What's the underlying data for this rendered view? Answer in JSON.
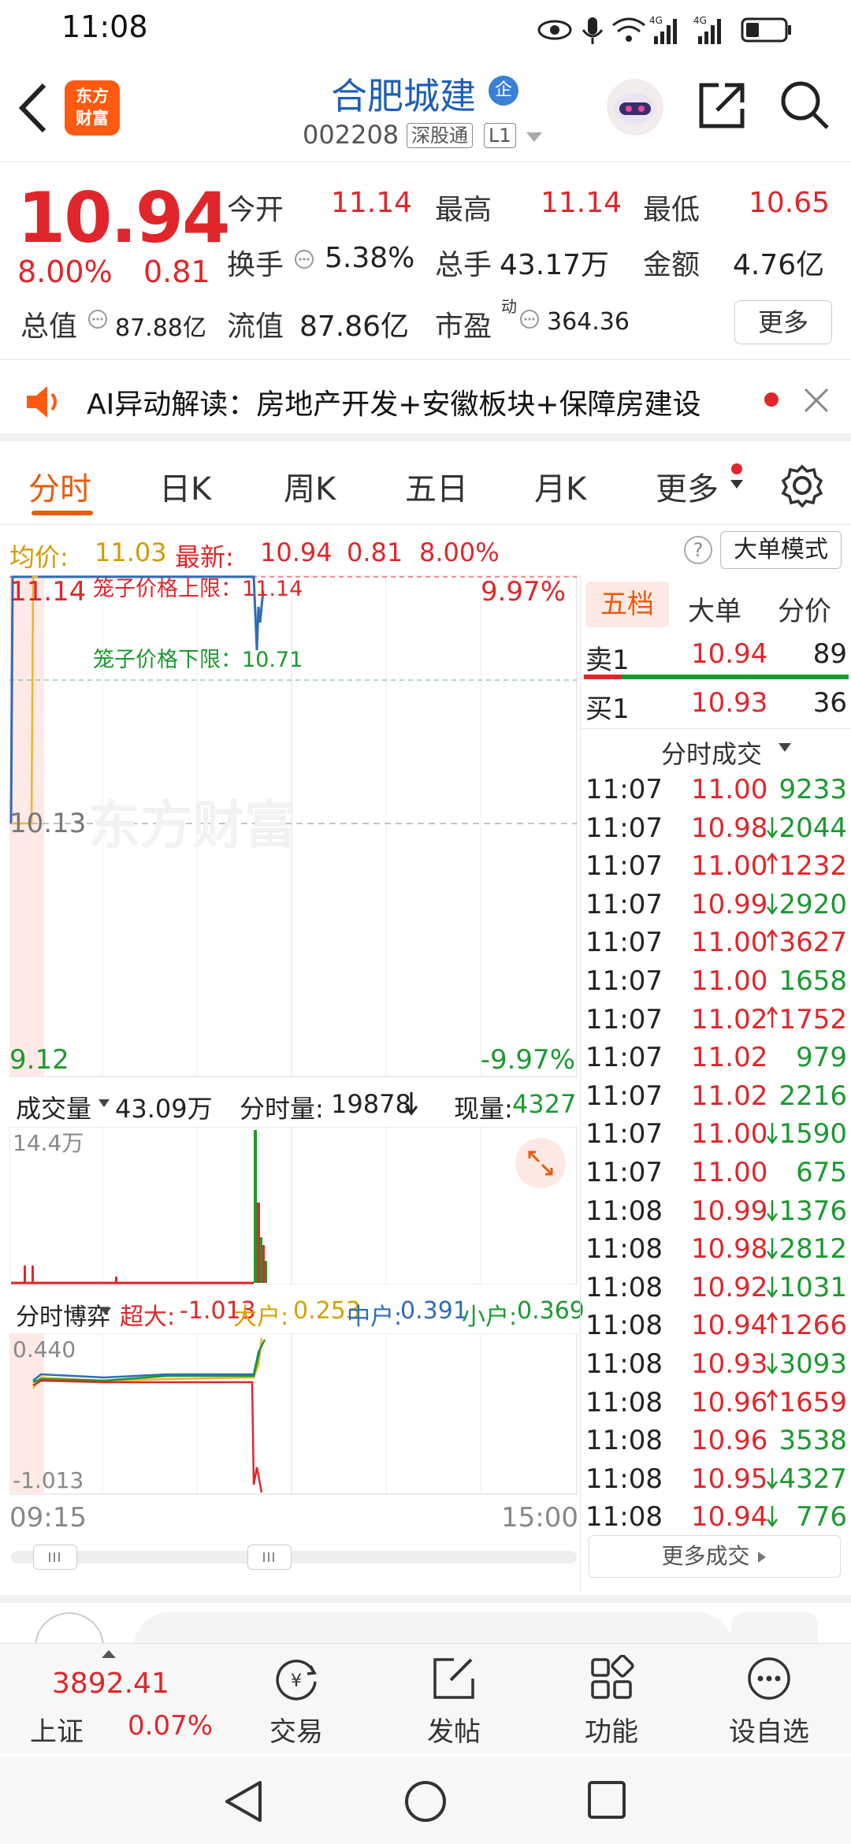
{
  "status_bar": {
    "time": "11:08",
    "network1": "4G",
    "network2": "4G"
  },
  "header": {
    "stock_name": "合肥城建",
    "name_tag": "企",
    "stock_code": "002208",
    "tag_connect": "深股通",
    "tag_level": "L1",
    "logo_line1": "东方",
    "logo_line2": "财富"
  },
  "quote": {
    "price": "10.94",
    "change_pct": "8.00%",
    "change": "0.81",
    "open_label": "今开",
    "open": "11.14",
    "high_label": "最高",
    "high": "11.14",
    "low_label": "最低",
    "low": "10.65",
    "turnover_label": "换手",
    "turnover": "5.38%",
    "volume_label": "总手",
    "volume": "43.17万",
    "amount_label": "金额",
    "amount": "4.76亿",
    "mktcap_label": "总值",
    "mktcap": "87.88亿",
    "float_label": "流值",
    "float_cap": "87.86亿",
    "pe_label": "市盈",
    "pe_sup": "动",
    "pe": "364.36",
    "more_button": "更多"
  },
  "ai_banner": {
    "text": "AI异动解读：房地产开发+安徽板块+保障房建设"
  },
  "tabs": [
    "分时",
    "日K",
    "周K",
    "五日",
    "月K",
    "更多"
  ],
  "avg_line": {
    "avg_label": "均价:",
    "avg": "11.03",
    "latest_label": "最新:",
    "latest": "10.94",
    "change": "0.81",
    "pct": "8.00%",
    "mode_button": "大单模式",
    "help": "?"
  },
  "intraday": {
    "top_price": "11.14",
    "top_pct": "9.97%",
    "mid_price": "10.13",
    "bottom_price": "9.12",
    "bottom_pct": "-9.97%",
    "upper_limit_label": "笼子价格上限：11.14",
    "lower_limit_label": "笼子价格下限：10.71",
    "watermark": "东方财富"
  },
  "volume_bar": {
    "selector": "成交量",
    "total": "43.09万",
    "minute_label": "分时量:",
    "minute": "19878",
    "now_label": "现量:",
    "now": "4327",
    "max_label": "14.4万"
  },
  "bo_yi": {
    "selector": "分时博弈",
    "super_label": "超大:",
    "super": "-1.013",
    "large_label": "大户:",
    "large": "0.253",
    "mid_label": "中户:",
    "mid": "0.391",
    "small_label": "小户:",
    "small": "0.369",
    "top_val": "0.440",
    "bottom_val": "-1.013"
  },
  "time_axis": {
    "start": "09:15",
    "end": "15:00"
  },
  "order_book": {
    "tabs": [
      "五档",
      "大单",
      "分价"
    ],
    "sell1_label": "卖1",
    "sell1_price": "10.94",
    "sell1_vol": "89",
    "buy1_label": "买1",
    "buy1_price": "10.93",
    "buy1_vol": "36",
    "ticks_header": "分时成交",
    "more_trades": "更多成交"
  },
  "trades": [
    {
      "time": "11:07",
      "price": "11.00",
      "vol": "9233",
      "dir": ""
    },
    {
      "time": "11:07",
      "price": "10.98",
      "vol": "2044",
      "dir": "down"
    },
    {
      "time": "11:07",
      "price": "11.00",
      "vol": "1232",
      "dir": "up"
    },
    {
      "time": "11:07",
      "price": "10.99",
      "vol": "2920",
      "dir": "down"
    },
    {
      "time": "11:07",
      "price": "11.00",
      "vol": "3627",
      "dir": "up"
    },
    {
      "time": "11:07",
      "price": "11.00",
      "vol": "1658",
      "dir": ""
    },
    {
      "time": "11:07",
      "price": "11.02",
      "vol": "1752",
      "dir": "up"
    },
    {
      "time": "11:07",
      "price": "11.02",
      "vol": "979",
      "dir": ""
    },
    {
      "time": "11:07",
      "price": "11.02",
      "vol": "2216",
      "dir": ""
    },
    {
      "time": "11:07",
      "price": "11.00",
      "vol": "1590",
      "dir": "down"
    },
    {
      "time": "11:07",
      "price": "11.00",
      "vol": "675",
      "dir": ""
    },
    {
      "time": "11:08",
      "price": "10.99",
      "vol": "1376",
      "dir": "down"
    },
    {
      "time": "11:08",
      "price": "10.98",
      "vol": "2812",
      "dir": "down"
    },
    {
      "time": "11:08",
      "price": "10.92",
      "vol": "1031",
      "dir": "down"
    },
    {
      "time": "11:08",
      "price": "10.94",
      "vol": "1266",
      "dir": "up"
    },
    {
      "time": "11:08",
      "price": "10.93",
      "vol": "3093",
      "dir": "down"
    },
    {
      "time": "11:08",
      "price": "10.96",
      "vol": "1659",
      "dir": "up"
    },
    {
      "time": "11:08",
      "price": "10.96",
      "vol": "3538",
      "dir": ""
    },
    {
      "time": "11:08",
      "price": "10.95",
      "vol": "4327",
      "dir": "down"
    },
    {
      "time": "11:08",
      "price": "10.94",
      "vol": "776",
      "dir": "down"
    }
  ],
  "bottom_nav": {
    "index_value": "3892.41",
    "index_name": "上证",
    "index_pct": "0.07%",
    "items": [
      "交易",
      "发帖",
      "功能",
      "设自选"
    ]
  },
  "colors": {
    "up": "#e0262a",
    "down": "#1a9a2e",
    "accent": "#ea5b0c",
    "price_line": "#2f6db5",
    "avg_line": "#f0b429"
  }
}
